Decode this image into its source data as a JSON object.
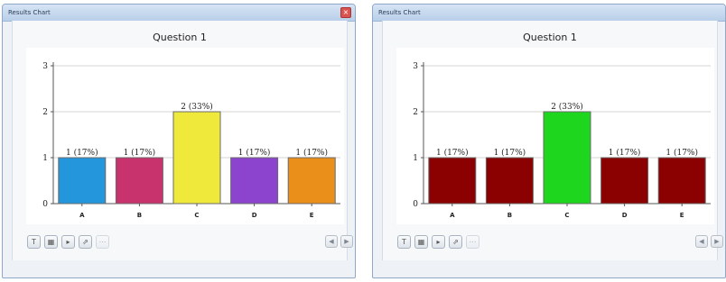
{
  "windows": [
    {
      "title": "Results Chart",
      "chart_title": "Question 1",
      "show_close": true,
      "close_glyph": "×",
      "colors": [
        "#2396dc",
        "#c8336e",
        "#eee93a",
        "#8c44cf",
        "#e98f1a"
      ]
    },
    {
      "title": "Results Chart",
      "chart_title": "Question 1",
      "show_close": false,
      "colors": [
        "#8b0000",
        "#8b0000",
        "#1fd61f",
        "#8b0000",
        "#8b0000"
      ]
    }
  ],
  "toolbar": {
    "buttons": [
      {
        "icon": "text-format-icon",
        "glyph": "T",
        "enabled": true
      },
      {
        "icon": "table-icon",
        "glyph": "▦",
        "enabled": true
      },
      {
        "icon": "next-page-icon",
        "glyph": "▸",
        "enabled": true
      },
      {
        "icon": "chart-export-icon",
        "glyph": "⇗",
        "enabled": true
      },
      {
        "icon": "disabled-action-icon",
        "glyph": "⋯",
        "enabled": false
      }
    ],
    "nav": [
      {
        "icon": "previous-arrow-icon",
        "glyph": "◀"
      },
      {
        "icon": "next-arrow-icon",
        "glyph": "▶"
      }
    ]
  },
  "chart_data": [
    {
      "type": "bar",
      "title": "Question 1",
      "categories": [
        "A",
        "B",
        "C",
        "D",
        "E"
      ],
      "values": [
        1,
        1,
        2,
        1,
        1
      ],
      "data_labels": [
        "1 (17%)",
        "1 (17%)",
        "2 (33%)",
        "1 (17%)",
        "1 (17%)"
      ],
      "ylim": [
        0,
        3
      ],
      "yticks": [
        "0",
        "1",
        "2",
        "3"
      ],
      "grid": true
    },
    {
      "type": "bar",
      "title": "Question 1",
      "categories": [
        "A",
        "B",
        "C",
        "D",
        "E"
      ],
      "values": [
        1,
        1,
        2,
        1,
        1
      ],
      "data_labels": [
        "1 (17%)",
        "1 (17%)",
        "2 (33%)",
        "1 (17%)",
        "1 (17%)"
      ],
      "ylim": [
        0,
        3
      ],
      "yticks": [
        "0",
        "1",
        "2",
        "3"
      ],
      "grid": true
    }
  ]
}
